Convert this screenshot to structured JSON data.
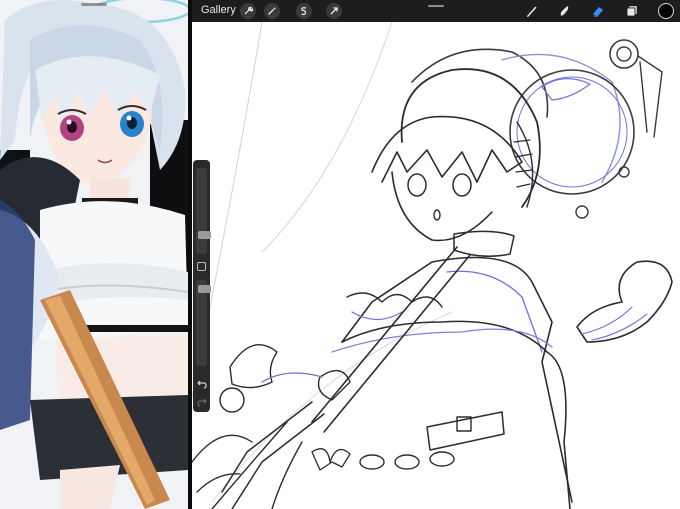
{
  "toolbar": {
    "gallery_label": "Gallery",
    "left_tools": [
      "wrench-icon",
      "magic-wand-icon",
      "selection-icon",
      "transform-arrow-icon"
    ],
    "right_tools": [
      "brush-icon",
      "smudge-icon",
      "eraser-icon",
      "layers-icon"
    ],
    "active_tool": "eraser-icon",
    "current_color": "#050505"
  },
  "sidebar": {
    "controls": [
      "brush-size-slider",
      "modify-button",
      "opacity-slider",
      "undo-button",
      "redo-button"
    ]
  },
  "colors": {
    "toolbar_bg": "#1d1d1f",
    "eraser_active": "#3f8cff",
    "canvas_bg": "#ffffff",
    "sketch_blue": "#6e6fd8"
  }
}
